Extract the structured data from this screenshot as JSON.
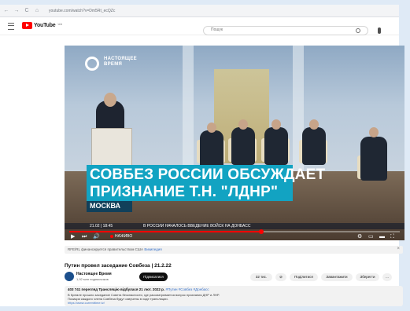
{
  "browser": {
    "back": "←",
    "forward": "→",
    "reload": "C",
    "home": "⌂",
    "url": "youtube.com/watch?v=Dm5Rt_ecQZc"
  },
  "header": {
    "logo_text": "YouTube",
    "logo_sup": "UA",
    "search_placeholder": "Пошук"
  },
  "video": {
    "channel_logo_text": "НАСТОЯЩЕЕ ВРЕМЯ",
    "caption_line1": "СОВБЕЗ РОССИИ ОБСУЖДАЕТ",
    "caption_line2": "ПРИЗНАНИЕ Т.Н. \"ЛДНР\"",
    "caption_location": "МОСКВА",
    "ticker_time": "21.02 | 18:45",
    "ticker_text": "В РОССИИ НАЧАЛОСЬ ВВЕДЕНИЕ ВОЙСК НА ДОНБАСС",
    "progress": 0.58,
    "controls": {
      "play": "▶",
      "next": "⏭",
      "volume": "🔊",
      "live": "НАЖИВО",
      "settings": "⚙",
      "miniplayer": "▭",
      "theater": "▬",
      "fullscreen": "⛶"
    }
  },
  "info_banner": {
    "text": "RFE/RL финансируется правительством США",
    "link": "Википедия",
    "close": "×"
  },
  "title": "Путин провел заседание Совбеза | 21.2.22",
  "channel": {
    "name": "Настоящее Время",
    "subs": "1,92 млн подписчиков",
    "subscribe": "Підписатися"
  },
  "actions": {
    "like": "32 тис.",
    "share": "Поділитися",
    "download": "Завантажити",
    "save": "Зберегти",
    "more": "…"
  },
  "description": {
    "meta": "403 741 перегляд  Трансляцію відбулася 21 лют. 2022 р.",
    "tags": "#Путин #Совбез #Донбасс",
    "line1": "В Кремле прошло заседание Совета безопасности, где рассматривается вопрос признания ДНР и ЛНР.",
    "line2": "Позиции каждого члена Совбеза будут озвучены в ходе трансляции.",
    "link": "https://www.currenttime.tv/"
  }
}
